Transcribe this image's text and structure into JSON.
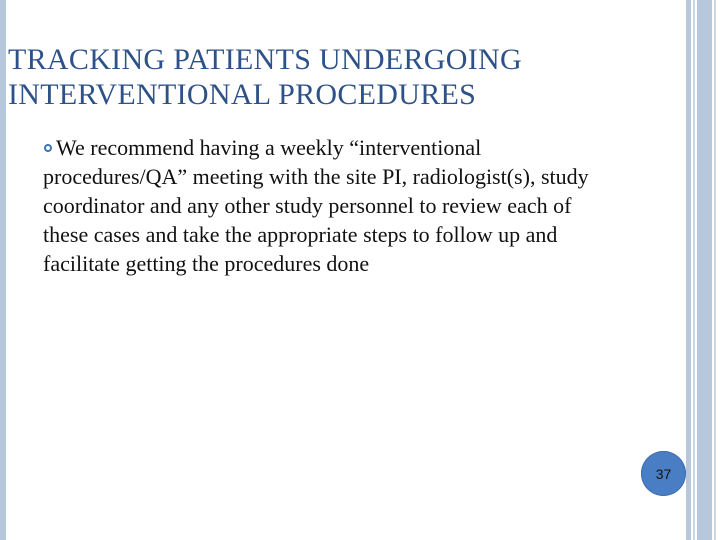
{
  "slide": {
    "title": "TRACKING PATIENTS UNDERGOING INTERVENTIONAL PROCEDURES",
    "bullet_text": "We recommend having a weekly “interventional procedures/QA” meeting with the site PI, radiologist(s), study coordinator and any other study personnel to review each of these cases and take the appropriate steps to follow up and facilitate getting the procedures done",
    "page_number": "37"
  },
  "colors": {
    "title": "#2e5288",
    "accent": "#3d73b9",
    "badge": "#4a7ec4",
    "stripe": "#b8c8dc"
  }
}
